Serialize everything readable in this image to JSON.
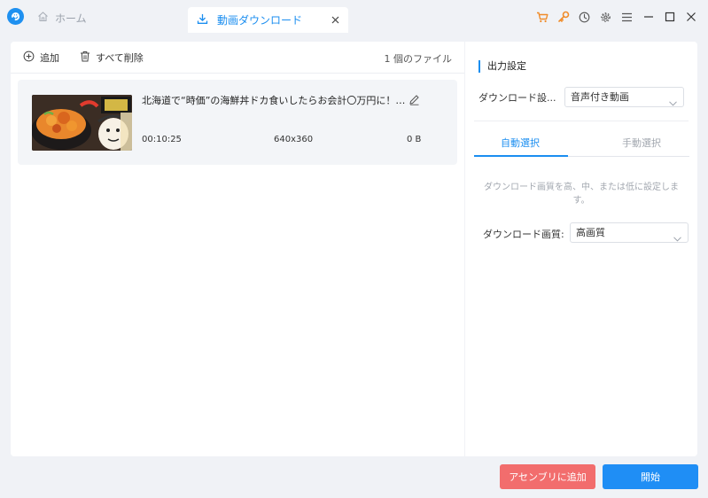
{
  "colors": {
    "accent": "#1b8ef0",
    "assembly_button": "#f26d6d",
    "start_button": "#1f8ef5",
    "toolbar_icons": "#f08c2a"
  },
  "tabs": {
    "home": {
      "label": "ホーム",
      "icon": "home-icon"
    },
    "download": {
      "label": "動画ダウンロード",
      "icon": "download-icon"
    }
  },
  "window_icons": [
    "cart-icon",
    "key-icon",
    "clock-icon",
    "gear-icon",
    "menu-icon",
    "minimize-icon",
    "maximize-icon",
    "close-icon"
  ],
  "toolbar": {
    "add_label": "追加",
    "delete_all_label": "すべて削除",
    "file_count": "1 個のファイル"
  },
  "video": {
    "title": "北海道で“時価”の海鮮丼ドカ食いしたらお会計〇万円に！？...",
    "duration": "00:10:25",
    "resolution": "640x360",
    "size": "0 B"
  },
  "settings": {
    "title": "出力設定",
    "download_setting_label": "ダウンロード設...",
    "download_setting_value": "音声付き動画",
    "tab_auto": "自動選択",
    "tab_manual": "手動選択",
    "hint": "ダウンロード画質を高、中、または低に設定します。",
    "quality_label": "ダウンロード画質:",
    "quality_value": "高画質"
  },
  "buttons": {
    "assembly": "アセンブリに追加",
    "start": "開始"
  }
}
